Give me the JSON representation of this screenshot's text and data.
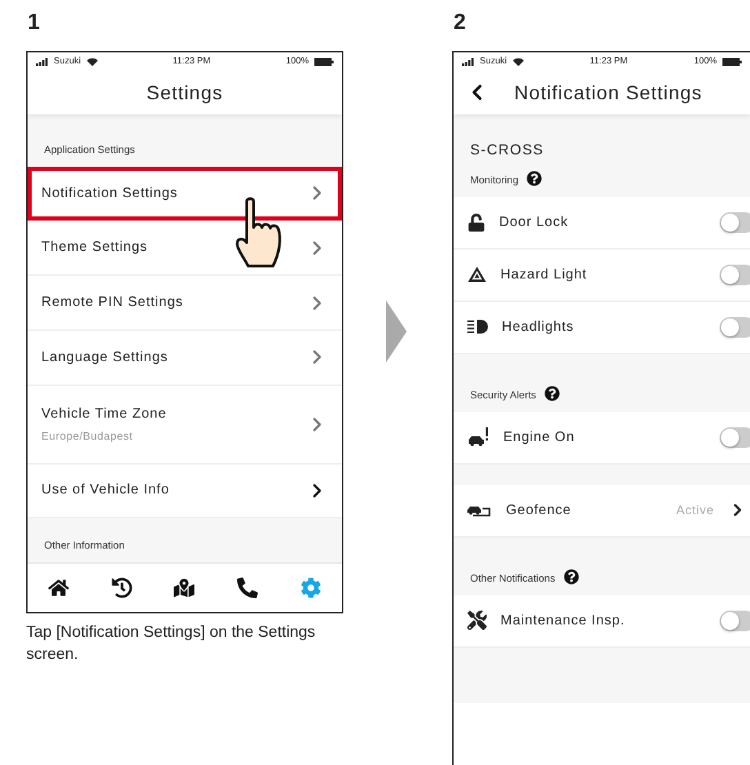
{
  "step_1": {
    "number": "1",
    "status_bar": {
      "carrier": "Suzuki",
      "time": "11:23 PM",
      "battery": "100%"
    },
    "title": "Settings",
    "sections": [
      {
        "header": "Application Settings",
        "items": [
          {
            "label": "Notification Settings",
            "highlighted": true
          },
          {
            "label": "Theme Settings",
            "highlighted": false
          },
          {
            "label": "Remote PIN Settings",
            "highlighted": false
          },
          {
            "label": "Language Settings",
            "highlighted": false
          },
          {
            "label": "Vehicle Time Zone",
            "sublabel": "Europe/Budapest",
            "highlighted": false
          },
          {
            "label": "Use of Vehicle Info",
            "highlighted": false
          }
        ]
      },
      {
        "header": "Other Information"
      }
    ],
    "nav": [
      {
        "selected": false
      },
      {
        "selected": false
      },
      {
        "selected": false
      },
      {
        "selected": false
      },
      {
        "selected": true
      }
    ],
    "caption": "Tap [Notification Settings] on the Settings screen."
  },
  "step_2": {
    "number": "2",
    "status_bar": {
      "carrier": "Suzuki",
      "time": "11:23 PM",
      "battery": "100%"
    },
    "title": "Notification Settings",
    "vehicle": "S-CROSS",
    "groups": [
      {
        "header": "Monitoring",
        "items": [
          {
            "kind": "toggle",
            "label": "Door Lock",
            "on": false
          },
          {
            "kind": "toggle",
            "label": "Hazard Light",
            "on": false
          },
          {
            "kind": "toggle",
            "label": "Headlights",
            "on": false
          }
        ]
      },
      {
        "header": "Security Alerts",
        "items": [
          {
            "kind": "toggle",
            "label": "Engine On",
            "on": false
          },
          {
            "kind": "link",
            "label": "Geofence",
            "value": "Active"
          }
        ]
      },
      {
        "header": "Other Notifications",
        "items": [
          {
            "kind": "toggle",
            "label": "Maintenance Insp.",
            "on": false
          }
        ]
      }
    ]
  }
}
